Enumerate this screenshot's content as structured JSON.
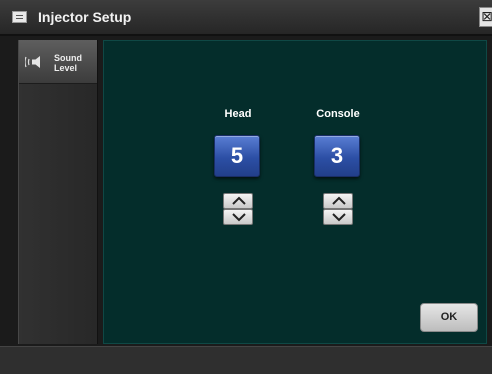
{
  "window": {
    "title": "Injector Setup",
    "close_glyph": "⊠"
  },
  "sidebar": {
    "items": [
      {
        "label": "Sound Level",
        "icon": "speaker-icon",
        "selected": true
      }
    ]
  },
  "main": {
    "controls": [
      {
        "label": "Head",
        "value": "5"
      },
      {
        "label": "Console",
        "value": "3"
      }
    ],
    "ok_label": "OK"
  },
  "colors": {
    "panel_background": "#042d2b",
    "value_box": "#2c4fa5",
    "titlebar": "#2e2e2e"
  }
}
